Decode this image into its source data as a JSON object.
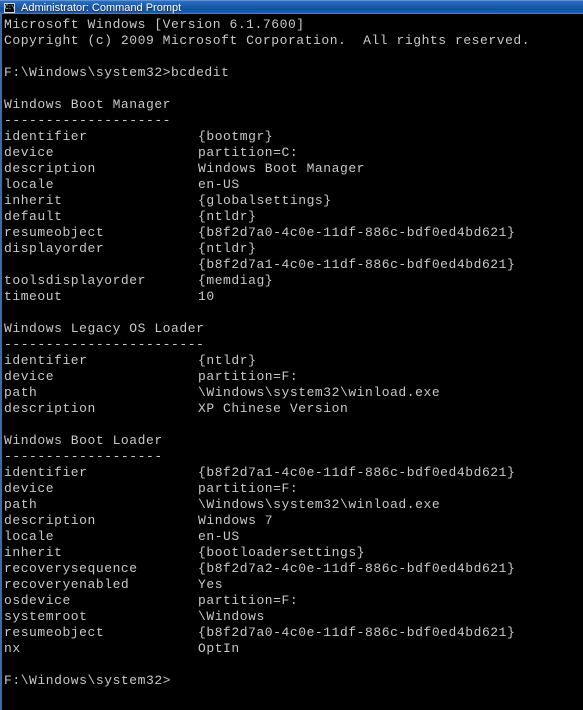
{
  "window": {
    "title": "Administrator: Command Prompt",
    "icon_name": "cmd-icon",
    "icon_glyph": "C:\\.",
    "minimize_label": "",
    "titlebar_color": "#1b5ca8",
    "titlebar_text_color": "#ffffff",
    "client_bg": "#000000",
    "client_fg": "#c9c9c9",
    "border_color": "#3e6e9e"
  },
  "console": {
    "banner": [
      "Microsoft Windows [Version 6.1.7600]",
      "Copyright (c) 2009 Microsoft Corporation.  All rights reserved."
    ],
    "prompt_command": {
      "prompt": "F:\\Windows\\system32>",
      "command": "bcdedit"
    },
    "final_prompt": "F:\\Windows\\system32>",
    "sections": [
      {
        "title": "Windows Boot Manager",
        "rule": "--------------------",
        "entries": [
          {
            "key": "identifier",
            "value": "{bootmgr}"
          },
          {
            "key": "device",
            "value": "partition=C:"
          },
          {
            "key": "description",
            "value": "Windows Boot Manager"
          },
          {
            "key": "locale",
            "value": "en-US"
          },
          {
            "key": "inherit",
            "value": "{globalsettings}"
          },
          {
            "key": "default",
            "value": "{ntldr}"
          },
          {
            "key": "resumeobject",
            "value": "{b8f2d7a0-4c0e-11df-886c-bdf0ed4bd621}"
          },
          {
            "key": "displayorder",
            "value": "{ntldr}"
          },
          {
            "key": "",
            "value": "{b8f2d7a1-4c0e-11df-886c-bdf0ed4bd621}"
          },
          {
            "key": "toolsdisplayorder",
            "value": "{memdiag}"
          },
          {
            "key": "timeout",
            "value": "10"
          }
        ]
      },
      {
        "title": "Windows Legacy OS Loader",
        "rule": "------------------------",
        "entries": [
          {
            "key": "identifier",
            "value": "{ntldr}"
          },
          {
            "key": "device",
            "value": "partition=F:"
          },
          {
            "key": "path",
            "value": "\\Windows\\system32\\winload.exe"
          },
          {
            "key": "description",
            "value": "XP Chinese Version"
          }
        ]
      },
      {
        "title": "Windows Boot Loader",
        "rule": "-------------------",
        "entries": [
          {
            "key": "identifier",
            "value": "{b8f2d7a1-4c0e-11df-886c-bdf0ed4bd621}"
          },
          {
            "key": "device",
            "value": "partition=F:"
          },
          {
            "key": "path",
            "value": "\\Windows\\system32\\winload.exe"
          },
          {
            "key": "description",
            "value": "Windows 7"
          },
          {
            "key": "locale",
            "value": "en-US"
          },
          {
            "key": "inherit",
            "value": "{bootloadersettings}"
          },
          {
            "key": "recoverysequence",
            "value": "{b8f2d7a2-4c0e-11df-886c-bdf0ed4bd621}"
          },
          {
            "key": "recoveryenabled",
            "value": "Yes"
          },
          {
            "key": "osdevice",
            "value": "partition=F:"
          },
          {
            "key": "systemroot",
            "value": "\\Windows"
          },
          {
            "key": "resumeobject",
            "value": "{b8f2d7a0-4c0e-11df-886c-bdf0ed4bd621}"
          },
          {
            "key": "nx",
            "value": "OptIn"
          }
        ]
      }
    ]
  }
}
